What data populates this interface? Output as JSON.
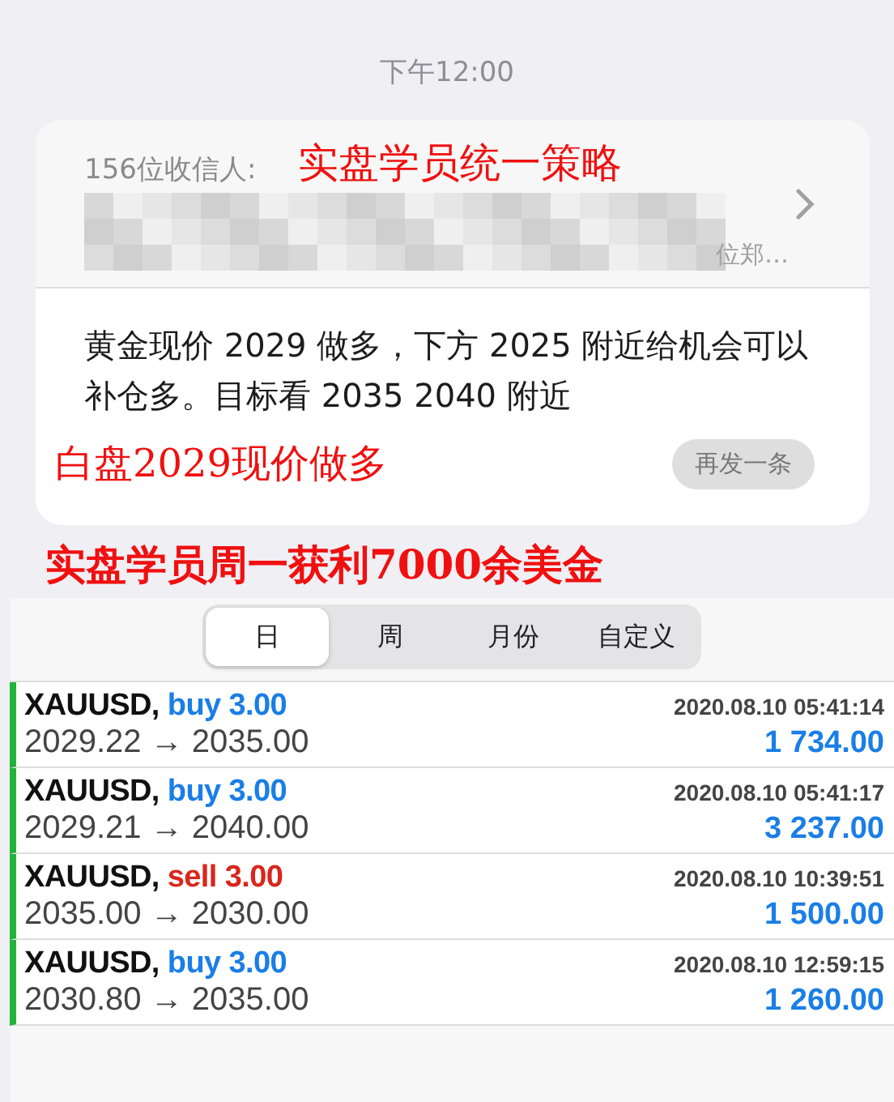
{
  "timestamp": "下午12:00",
  "message": {
    "recipients_label": "156位收信人:",
    "recipients_tail": "位郑…",
    "body": "黄金现价 2029 做多，下方 2025 附近给机会可以补仓多。目标看 2035 2040 附近",
    "resend_button": "再发一条"
  },
  "annotations": [
    "实盘学员统一策略",
    "白盘2029现价做多",
    "实盘学员周一获利7000余美金"
  ],
  "tabs": [
    {
      "label": "日",
      "selected": true
    },
    {
      "label": "周",
      "selected": false
    },
    {
      "label": "月份",
      "selected": false
    },
    {
      "label": "自定义",
      "selected": false
    }
  ],
  "trades": [
    {
      "symbol": "XAUUSD,",
      "side": "buy",
      "volume": "3.00",
      "prices": "2029.22 → 2035.00",
      "time": "2020.08.10 05:41:14",
      "profit": "1 734.00"
    },
    {
      "symbol": "XAUUSD,",
      "side": "buy",
      "volume": "3.00",
      "prices": "2029.21 → 2040.00",
      "time": "2020.08.10 05:41:17",
      "profit": "3 237.00"
    },
    {
      "symbol": "XAUUSD,",
      "side": "sell",
      "volume": "3.00",
      "prices": "2035.00 → 2030.00",
      "time": "2020.08.10 10:39:51",
      "profit": "1 500.00"
    },
    {
      "symbol": "XAUUSD,",
      "side": "buy",
      "volume": "3.00",
      "prices": "2030.80 → 2035.00",
      "time": "2020.08.10 12:59:15",
      "profit": "1 260.00"
    }
  ]
}
